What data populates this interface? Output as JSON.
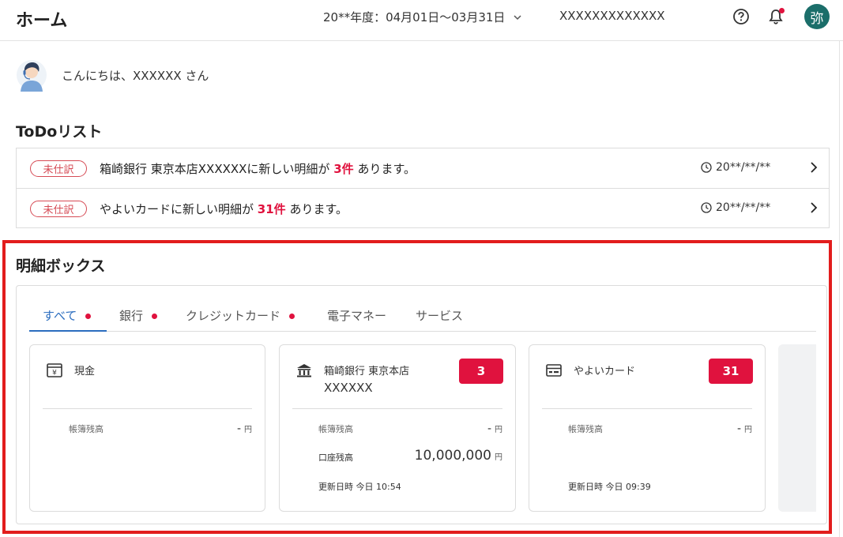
{
  "header": {
    "title": "ホーム",
    "period": "20**年度：04月01日〜03月31日",
    "company": "XXXXXXXXXXXXX",
    "user_initial": "弥"
  },
  "greeting": "こんにちは、XXXXXX さん",
  "todo": {
    "title": "ToDoリスト",
    "items": [
      {
        "badge": "未仕訳",
        "prefix": "箱崎銀行 東京本店XXXXXXに新しい明細が",
        "count": "3件",
        "suffix": "あります。",
        "date": "20**/**/**"
      },
      {
        "badge": "未仕訳",
        "prefix": "やよいカードに新しい明細が",
        "count": "31件",
        "suffix": "あります。",
        "date": "20**/**/**"
      }
    ]
  },
  "statement_box": {
    "title": "明細ボックス",
    "tabs": [
      {
        "label": "すべて",
        "active": true,
        "dot": true
      },
      {
        "label": "銀行",
        "active": false,
        "dot": true
      },
      {
        "label": "クレジットカード",
        "active": false,
        "dot": true
      },
      {
        "label": "電子マネー",
        "active": false,
        "dot": false
      },
      {
        "label": "サービス",
        "active": false,
        "dot": false
      }
    ],
    "cards": [
      {
        "name": "現金",
        "icon": "cash-register-icon",
        "book_label": "帳簿残高",
        "book_value": "-",
        "unit": "円"
      },
      {
        "name_line1": "箱崎銀行 東京本店",
        "name_line2": "XXXXXX",
        "icon": "bank-icon",
        "count": "3",
        "book_label": "帳簿残高",
        "book_value": "-",
        "account_label": "口座残高",
        "account_value": "10,000,000",
        "unit": "円",
        "updated": "更新日時 今日 10:54"
      },
      {
        "name": "やよいカード",
        "icon": "credit-card-icon",
        "count": "31",
        "book_label": "帳簿残高",
        "book_value": "-",
        "unit": "円",
        "updated": "更新日時 今日 09:39"
      }
    ]
  },
  "colors": {
    "accent_red": "#e0123e",
    "tab_blue": "#2b6dbf",
    "avatar_green": "#1b6e6a",
    "highlight_red": "#e21d1d"
  }
}
